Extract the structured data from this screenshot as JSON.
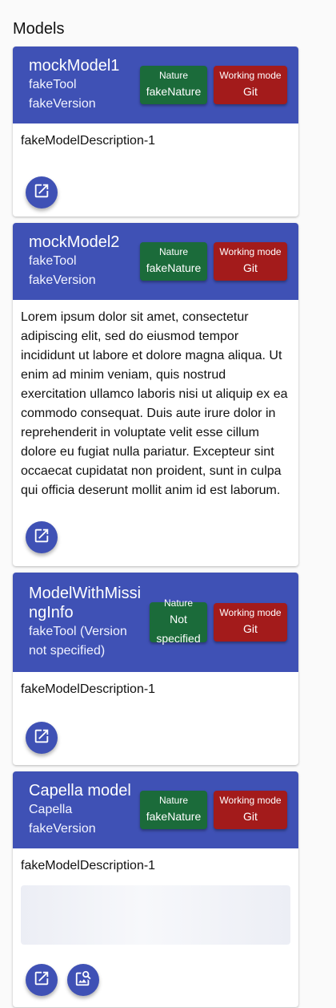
{
  "page": {
    "title": "Models"
  },
  "models": [
    {
      "name": "mockModel1",
      "tool": "fakeTool",
      "version": "fakeVersion",
      "nature_label": "Nature",
      "nature_value": "fakeNature",
      "mode_label": "Working mode",
      "mode_value": "Git",
      "description": "fakeModelDescription-1"
    },
    {
      "name": "mockModel2",
      "tool": "fakeTool",
      "version": "fakeVersion",
      "nature_label": "Nature",
      "nature_value": "fakeNature",
      "mode_label": "Working mode",
      "mode_value": "Git",
      "description": "Lorem ipsum dolor sit amet, consectetur adipiscing elit, sed do eiusmod tempor incididunt ut labore et dolore magna aliqua. Ut enim ad minim veniam, quis nostrud exercitation ullamco laboris nisi ut aliquip ex ea commodo consequat. Duis aute irure dolor in reprehenderit in voluptate velit esse cillum dolore eu fugiat nulla pariatur. Excepteur sint occaecat cupidatat non proident, sunt in culpa qui officia deserunt mollit anim id est laborum."
    },
    {
      "name": "ModelWithMissingInfo",
      "tool_version": "fakeTool (Version not specified)",
      "nature_label": "Nature",
      "nature_value": "Not specified",
      "mode_label": "Working mode",
      "mode_value": "Git",
      "description": "fakeModelDescription-1"
    },
    {
      "name": "Capella model",
      "tool": "Capella",
      "version": "fakeVersion",
      "nature_label": "Nature",
      "nature_value": "fakeNature",
      "mode_label": "Working mode",
      "mode_value": "Git",
      "description": "fakeModelDescription-1"
    }
  ],
  "icons": {
    "open": "open-in-new-icon",
    "diagram": "image-search-icon"
  },
  "colors": {
    "header": "#3f51b5",
    "nature_chip": "#1b6b3a",
    "mode_chip": "#a31b1b"
  }
}
